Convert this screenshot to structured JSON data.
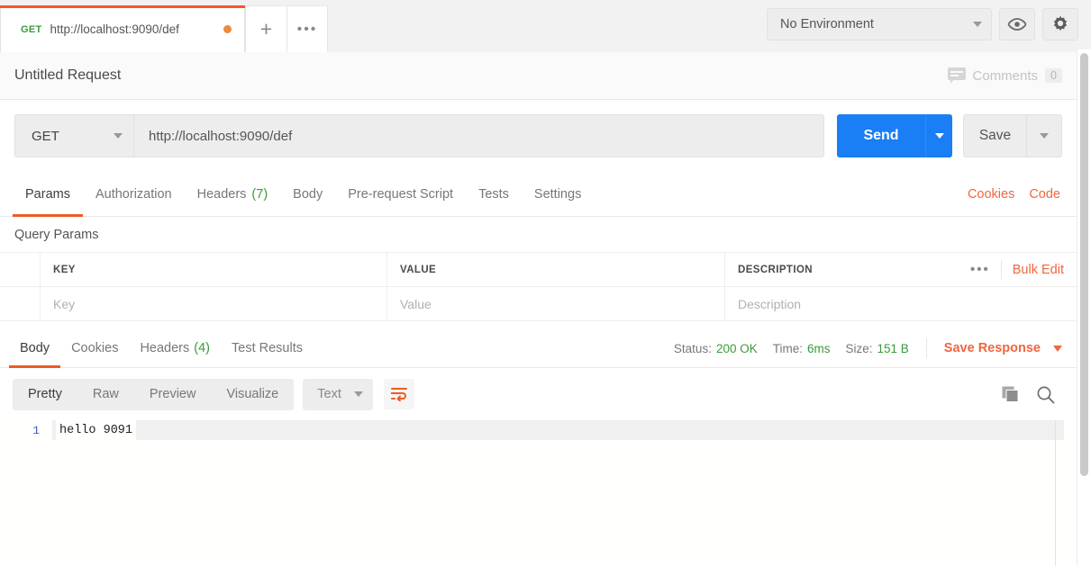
{
  "tabstrip": {
    "request_tab": {
      "method": "GET",
      "url": "http://localhost:9090/def",
      "unsaved_dot": "●"
    },
    "new_tab_label": "+",
    "more_tabs_label": "•••",
    "environment": {
      "selected": "No Environment"
    },
    "eye_icon": "eye-icon",
    "gear_icon": "gear-icon"
  },
  "title_row": {
    "request_name": "Untitled Request",
    "comments_label": "Comments",
    "comments_count": "0"
  },
  "url_row": {
    "method": "GET",
    "url_value": "http://localhost:9090/def",
    "send_label": "Send",
    "save_label": "Save"
  },
  "request_tabs": {
    "items": [
      {
        "label": "Params",
        "badge": "",
        "active": true
      },
      {
        "label": "Authorization",
        "badge": "",
        "active": false
      },
      {
        "label": "Headers",
        "badge": "(7)",
        "active": false
      },
      {
        "label": "Body",
        "badge": "",
        "active": false
      },
      {
        "label": "Pre-request Script",
        "badge": "",
        "active": false
      },
      {
        "label": "Tests",
        "badge": "",
        "active": false
      },
      {
        "label": "Settings",
        "badge": "",
        "active": false
      }
    ],
    "cookies_label": "Cookies",
    "code_label": "Code"
  },
  "query_params": {
    "section_title": "Query Params",
    "headers": {
      "key": "KEY",
      "value": "VALUE",
      "description": "DESCRIPTION"
    },
    "more_label": "•••",
    "bulk_edit_label": "Bulk Edit",
    "placeholders": {
      "key": "Key",
      "value": "Value",
      "description": "Description"
    }
  },
  "response_tabs": {
    "items": [
      {
        "label": "Body",
        "badge": "",
        "active": true
      },
      {
        "label": "Cookies",
        "badge": "",
        "active": false
      },
      {
        "label": "Headers",
        "badge": "(4)",
        "active": false
      },
      {
        "label": "Test Results",
        "badge": "",
        "active": false
      }
    ],
    "status_label": "Status:",
    "status_value": "200 OK",
    "time_label": "Time:",
    "time_value": "6ms",
    "size_label": "Size:",
    "size_value": "151 B",
    "save_response_label": "Save Response"
  },
  "body_toolbar": {
    "view_modes": [
      {
        "label": "Pretty",
        "active": true
      },
      {
        "label": "Raw",
        "active": false
      },
      {
        "label": "Preview",
        "active": false
      },
      {
        "label": "Visualize",
        "active": false
      }
    ],
    "format": "Text",
    "wrap_icon": "word-wrap-icon",
    "copy_icon": "copy-icon",
    "search_icon": "search-icon"
  },
  "response_body": {
    "lines": [
      {
        "number": "1",
        "text": "hello 9091"
      }
    ]
  },
  "colors": {
    "accent_orange": "#ef5b25",
    "link_orange": "#f0663f",
    "send_blue": "#1a7ef4",
    "success_green": "#3a9a3a",
    "panel_gray": "#ededed"
  }
}
